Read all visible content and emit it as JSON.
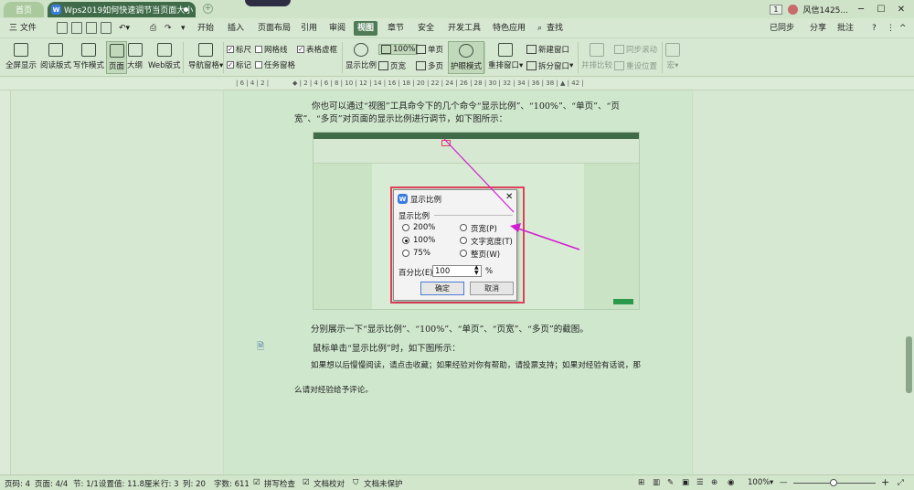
{
  "tabs": {
    "home": "首页",
    "doc": "Wps2019如何快速调节当页面大小"
  },
  "title_right": {
    "badge": "1",
    "user": "风信1425...",
    "min": "─",
    "max": "☐",
    "close": "✕"
  },
  "menu": {
    "file": "三 文件",
    "items": [
      "开始",
      "插入",
      "页面布局",
      "引用",
      "审阅",
      "视图",
      "章节",
      "安全",
      "开发工具",
      "特色应用"
    ],
    "search": "查找",
    "right": {
      "sync": "已同步",
      "share": "分享",
      "comment": "批注",
      "help": "?",
      "more": "⋮",
      "collapse": "^"
    }
  },
  "ribbon": {
    "fullscreen": "全屏显示",
    "reading": "阅读版式",
    "writing": "写作模式",
    "page": "页面",
    "outline": "大纲",
    "web": "Web版式",
    "nav": "导航窗格",
    "ruler": "标尺",
    "grid": "网格线",
    "table_grid": "表格虚框",
    "mark": "标记",
    "task_pane": "任务窗格",
    "zoom_label": "显示比例",
    "zoom_100": "100%",
    "single": "单页",
    "page_width": "页宽",
    "multi": "多页",
    "eye": "护眼模式",
    "rearrange": "重排窗口",
    "new_window": "新建窗口",
    "split": "拆分窗口",
    "side_by_side": "并排比较",
    "sync_scroll": "同步滚动",
    "reset_pos": "重设位置",
    "macro": "宏"
  },
  "doc": {
    "line1": "你也可以通过“视图”工具命令下的几个命令“显示比例”、“100%”、“单页”、“页",
    "line2": "宽”、“多页”对页面的显示比例进行调节，如下图所示：",
    "line3": "分别展示一下“显示比例”、“100%”、“单页”、“页宽”、“多页”的截图。",
    "line4": "鼠标单击“显示比例”时，如下图所示：",
    "line5": "如果想以后慢慢阅读，请点击收藏；如果经验对你有帮助，请投票支持；如果对经验有话说，那",
    "line6": "么请对经验给予评论。"
  },
  "dialog": {
    "title": "显示比例",
    "group": "显示比例",
    "opt200": "200%",
    "opt100": "100%",
    "opt75": "75%",
    "page_width": "页宽(P)",
    "text_width": "文字宽度(T)",
    "whole_page": "整页(W)",
    "percent_label": "百分比(E):",
    "percent_value": "100",
    "percent_unit": "%",
    "ok": "确定",
    "cancel": "取消"
  },
  "status": {
    "page_num": "页码: 4",
    "pages": "页面: 4/4",
    "section": "节: 1/1",
    "setting": "设置值: 11.8厘米",
    "row": "行: 3",
    "col": "列: 20",
    "words": "字数: 611",
    "spell": "拼写检查",
    "proof": "文档校对",
    "protect": "文档未保护",
    "zoom": "100%",
    "minus": "—",
    "plus": "+"
  },
  "colors": {
    "accent": "#4f7c57",
    "highlight_red": "#e0405a",
    "arrow_magenta": "#d21ed2"
  }
}
